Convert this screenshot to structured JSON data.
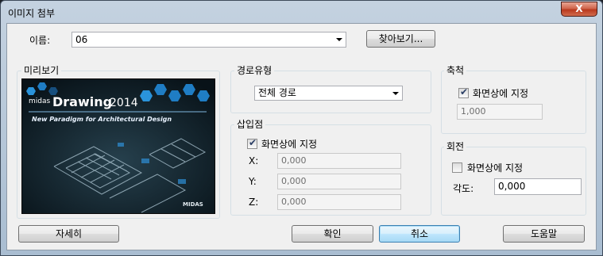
{
  "window": {
    "title": "이미지 첨부",
    "close_glyph": "X"
  },
  "name_row": {
    "label": "이름:",
    "value": "06",
    "browse_label": "찾아보기..."
  },
  "preview": {
    "group_title": "미리보기",
    "logo_small": "midas",
    "logo_big": "Drawing",
    "logo_year": "2014",
    "tagline": "New Paradigm for Architectural Design",
    "corner_logo": "MIDAS"
  },
  "path_type": {
    "group_title": "경로유형",
    "value": "전체 경로"
  },
  "insertion": {
    "group_title": "삽입점",
    "checkbox_label": "화면상에 지정",
    "checked": true,
    "x_label": "X:",
    "x_value": "0,000",
    "y_label": "Y:",
    "y_value": "0,000",
    "z_label": "Z:",
    "z_value": "0,000"
  },
  "scale": {
    "group_title": "축척",
    "checkbox_label": "화면상에 지정",
    "checked": true,
    "value": "1,000"
  },
  "rotation": {
    "group_title": "회전",
    "checkbox_label": "화면상에 지정",
    "checked": false,
    "angle_label": "각도:",
    "angle_value": "0,000"
  },
  "buttons": {
    "details": "자세히",
    "ok": "확인",
    "cancel": "취소",
    "help": "도움말"
  },
  "colors": {
    "preview_bg": "#0c1a23",
    "hex_accent": "#1f7dc4",
    "titlebar": "#b6c7d9"
  }
}
